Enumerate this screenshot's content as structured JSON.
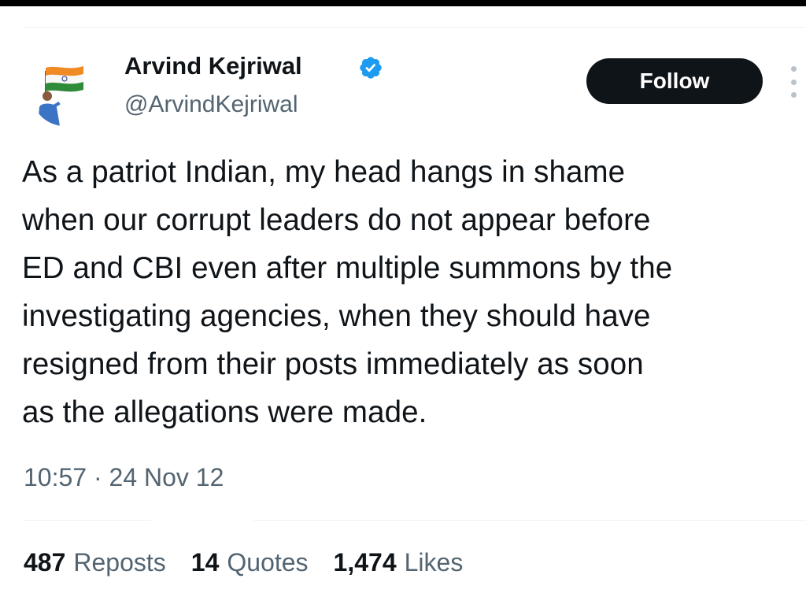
{
  "author": {
    "display_name": "Arvind Kejriwal",
    "handle": "@ArvindKejriwal",
    "verified": true
  },
  "actions": {
    "follow_label": "Follow",
    "more_icon": "more-vertical-icon"
  },
  "tweet": {
    "text": "As a patriot Indian, my head hangs in shame\nwhen our corrupt leaders do not appear before\nED and CBI even after multiple summons by the\ninvestigating agencies, when they should have\nresigned from their posts immediately as soon\nas the allegations were made.",
    "timestamp": "10:57 · 24 Nov 12"
  },
  "stats": {
    "reposts_count": "487",
    "reposts_label": "Reposts",
    "quotes_count": "14",
    "quotes_label": "Quotes",
    "likes_count": "1,474",
    "likes_label": "Likes"
  },
  "colors": {
    "verified_badge": "#1d9bf0",
    "follow_button_bg": "#0f1419",
    "secondary_text": "#536471"
  }
}
